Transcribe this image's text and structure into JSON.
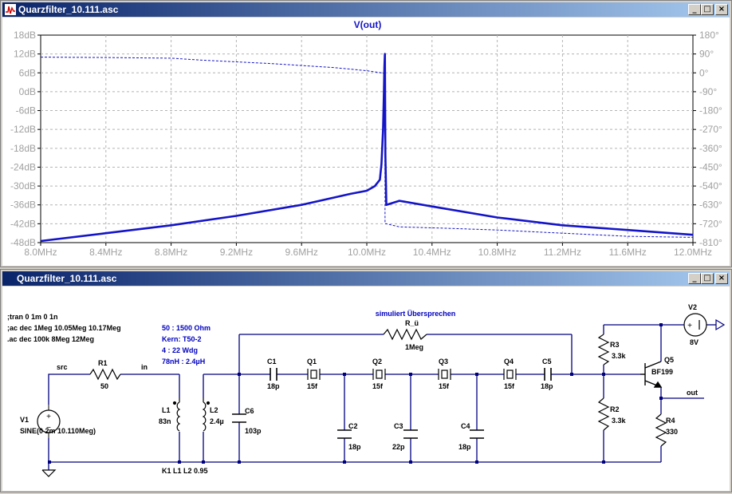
{
  "plot_window": {
    "title": "Quarzfilter_10.111.asc",
    "buttons": {
      "minimize": "_",
      "maximize": "□",
      "close": "×"
    },
    "trace_label": "V(out)",
    "colors": {
      "trace": "#1414c8",
      "plot_bg": "#ffffff",
      "axis_text": "#a0a0a0",
      "grid": "#b4b4b4"
    }
  },
  "chart_data": {
    "type": "line",
    "title": "V(out)",
    "x_ticks": [
      "8.0MHz",
      "8.4MHz",
      "8.8MHz",
      "9.2MHz",
      "9.6MHz",
      "10.0MHz",
      "10.4MHz",
      "10.8MHz",
      "11.2MHz",
      "11.6MHz",
      "12.0MHz"
    ],
    "y_left_ticks": [
      "18dB",
      "12dB",
      "6dB",
      "0dB",
      "-6dB",
      "-12dB",
      "-18dB",
      "-24dB",
      "-30dB",
      "-36dB",
      "-42dB",
      "-48dB"
    ],
    "y_right_ticks": [
      "180°",
      "90°",
      "0°",
      "-90°",
      "-180°",
      "-270°",
      "-360°",
      "-450°",
      "-540°",
      "-630°",
      "-720°",
      "-810°"
    ],
    "xlim": [
      8.0,
      12.0
    ],
    "ylim": [
      -48,
      18
    ],
    "y2lim": [
      -810,
      180
    ],
    "grid": true,
    "series": [
      {
        "style": "solid",
        "axis": "left",
        "x": [
          8.0,
          8.4,
          8.8,
          9.2,
          9.6,
          9.9,
          10.0,
          10.05,
          10.08,
          10.09,
          10.1,
          10.105,
          10.108,
          10.111,
          10.114,
          10.12,
          10.2,
          10.4,
          10.8,
          11.2,
          11.6,
          12.0
        ],
        "y": [
          -47.5,
          -45,
          -42.5,
          -39.5,
          -36,
          -32.5,
          -31.5,
          -30,
          -28,
          -23,
          -12,
          0,
          8,
          12,
          -20,
          -36,
          -34.7,
          -36.5,
          -40,
          -42.5,
          -44,
          -45.5
        ]
      },
      {
        "style": "dashed",
        "axis": "right",
        "x": [
          8.0,
          8.4,
          8.8,
          9.0,
          9.4,
          9.8,
          10.0,
          10.09,
          10.1,
          10.11,
          10.112,
          10.12,
          10.2,
          10.5,
          10.8,
          11.2,
          11.6,
          12.0
        ],
        "y": [
          75,
          73,
          70,
          60,
          45,
          25,
          10,
          0,
          0,
          -10,
          -720,
          -720,
          -735,
          -742,
          -750,
          -765,
          -780,
          -785
        ]
      }
    ]
  },
  "schematic_window": {
    "title": "Quarzfilter_10.111.asc",
    "buttons": {
      "minimize": "_",
      "maximize": "□",
      "close": "×"
    },
    "directives": [
      ";tran 0 1m 0 1n",
      ";ac dec 1Meg 10.05Meg 10.17Meg",
      ".ac dec 100k 8Meg 12Meg"
    ],
    "notes": [
      "50 : 1500 Ohm",
      "Kern: T50-2",
      "4 : 22 Wdg",
      "78nH : 2.4µH"
    ],
    "crosstalk_label": "simuliert Übersprechen",
    "coupling": "K1 L1 L2 0.95",
    "nets": {
      "src": "src",
      "in": "in",
      "out": "out"
    },
    "components": {
      "V1": {
        "name": "V1",
        "value": "SINE(0 2m 10.110Meg)"
      },
      "R1": {
        "name": "R1",
        "value": "50"
      },
      "L1": {
        "name": "L1",
        "value": "83n"
      },
      "L2": {
        "name": "L2",
        "value": "2.4µ"
      },
      "C6": {
        "name": "C6",
        "value": "103p"
      },
      "C1": {
        "name": "C1",
        "value": "18p"
      },
      "Q1": {
        "name": "Q1",
        "value": "15f"
      },
      "C2": {
        "name": "C2",
        "value": "18p"
      },
      "Q2": {
        "name": "Q2",
        "value": "15f"
      },
      "C3": {
        "name": "C3",
        "value": "22p"
      },
      "Q3": {
        "name": "Q3",
        "value": "15f"
      },
      "C4": {
        "name": "C4",
        "value": "18p"
      },
      "Q4": {
        "name": "Q4",
        "value": "15f"
      },
      "C5": {
        "name": "C5",
        "value": "18p"
      },
      "RU": {
        "name": "R_ü",
        "value": "1Meg"
      },
      "R3": {
        "name": "R3",
        "value": "3.3k"
      },
      "R2": {
        "name": "R2",
        "value": "3.3k"
      },
      "Q5": {
        "name": "Q5",
        "value": "BF199"
      },
      "R4": {
        "name": "R4",
        "value": "330"
      },
      "V2": {
        "name": "V2",
        "value": "8V"
      }
    },
    "colors": {
      "wire": "#000080",
      "component": "#000000",
      "text": "#000000",
      "note": "#0000c0"
    }
  }
}
